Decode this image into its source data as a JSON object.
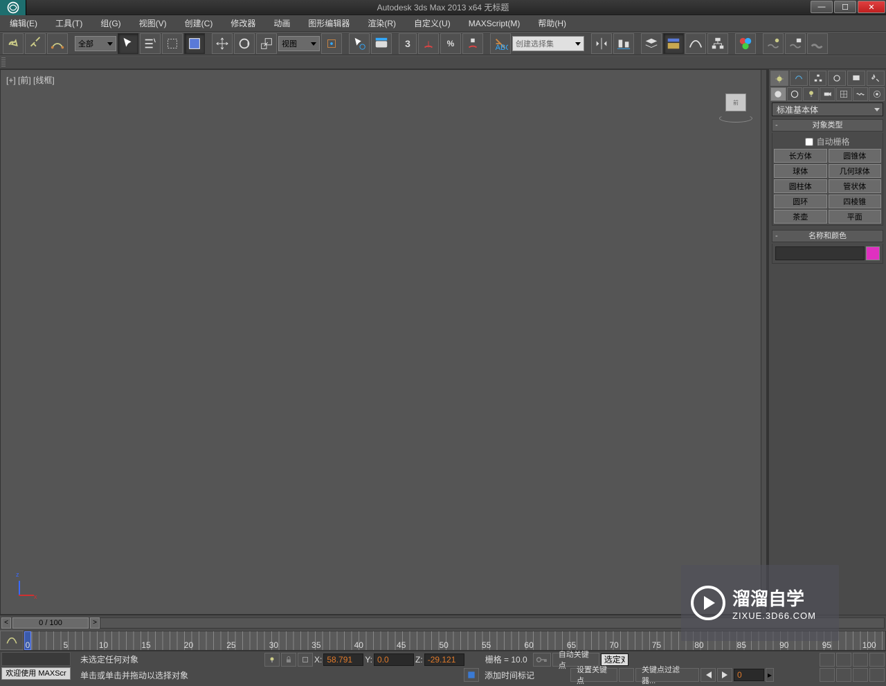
{
  "title": "Autodesk 3ds Max  2013 x64       无标题",
  "menu": [
    "编辑(E)",
    "工具(T)",
    "组(G)",
    "视图(V)",
    "创建(C)",
    "修改器",
    "动画",
    "图形编辑器",
    "渲染(R)",
    "自定义(U)",
    "MAXScript(M)",
    "帮助(H)"
  ],
  "toolbar": {
    "filter_dropdown": "全部",
    "ref_dropdown": "视图",
    "snap_label": "3",
    "named_sel_dropdown": "创建选择集"
  },
  "viewport": {
    "label": "[+] [前] [线框]",
    "cube_face": "前"
  },
  "cmdpanel": {
    "category_dropdown": "标准基本体",
    "rollout_objecttype": "对象类型",
    "autogrid": "自动栅格",
    "buttons": [
      "长方体",
      "圆锥体",
      "球体",
      "几何球体",
      "圆柱体",
      "管状体",
      "圆环",
      "四棱锥",
      "茶壶",
      "平面"
    ],
    "rollout_namecolor": "名称和颜色"
  },
  "timeline": {
    "slider_label": "0 / 100",
    "ticks": [
      "0",
      "5",
      "10",
      "15",
      "20",
      "25",
      "30",
      "35",
      "40",
      "45",
      "50",
      "55",
      "60",
      "65",
      "70",
      "75",
      "80",
      "85",
      "90",
      "95",
      "100"
    ]
  },
  "status": {
    "selection": "未选定任何对象",
    "hint": "单击或单击并拖动以选择对象",
    "x_label": "X:",
    "x_val": "58.791",
    "y_label": "Y:",
    "y_val": "0.0",
    "z_label": "Z:",
    "z_val": "-29.121",
    "grid": "栅格 = 10.0",
    "autokey": "自动关键点",
    "selected_edit": "选定对",
    "setkey": "设置关键点",
    "keyfilters": "关键点过滤器...",
    "addtimemark": "添加时间标记",
    "frame": "0",
    "maxscript_welcome": "欢迎使用 MAXScr"
  },
  "watermark": {
    "brand": "溜溜自学",
    "url": "ZIXUE.3D66.COM"
  }
}
